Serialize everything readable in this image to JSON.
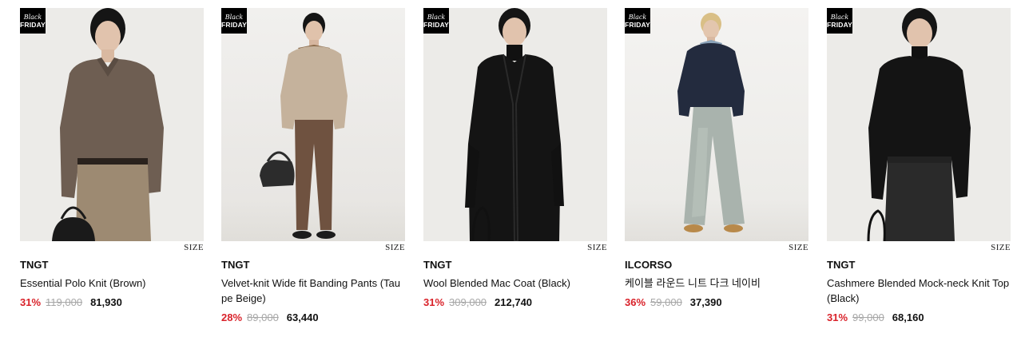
{
  "products": [
    {
      "badge": {
        "line1": "Black",
        "line2": "FRIDAY"
      },
      "size_label": "SIZE",
      "brand": "TNGT",
      "name": "Essential Polo Knit (Brown)",
      "discount": "31%",
      "original_price": "119,000",
      "price": "81,930"
    },
    {
      "badge": {
        "line1": "Black",
        "line2": "FRIDAY"
      },
      "size_label": "SIZE",
      "brand": "TNGT",
      "name": "Velvet-knit Wide fit Banding Pants (Taupe Beige)",
      "discount": "28%",
      "original_price": "89,000",
      "price": "63,440"
    },
    {
      "badge": {
        "line1": "Black",
        "line2": "FRIDAY"
      },
      "size_label": "SIZE",
      "brand": "TNGT",
      "name": "Wool Blended Mac Coat (Black)",
      "discount": "31%",
      "original_price": "309,000",
      "price": "212,740"
    },
    {
      "badge": {
        "line1": "Black",
        "line2": "FRIDAY"
      },
      "size_label": "SIZE",
      "brand": "ILCORSO",
      "name": "케이블 라운드 니트 다크 네이비",
      "discount": "36%",
      "original_price": "59,000",
      "price": "37,390"
    },
    {
      "badge": {
        "line1": "Black",
        "line2": "FRIDAY"
      },
      "size_label": "SIZE",
      "brand": "TNGT",
      "name": "Cashmere Blended Mock-neck Knit Top (Black)",
      "discount": "31%",
      "original_price": "99,000",
      "price": "68,160"
    }
  ],
  "colors": {
    "discount": "#d9222a",
    "original_price": "#a7a7a7",
    "badge_bg": "#000000",
    "photo_bg": "#ecebe8"
  }
}
